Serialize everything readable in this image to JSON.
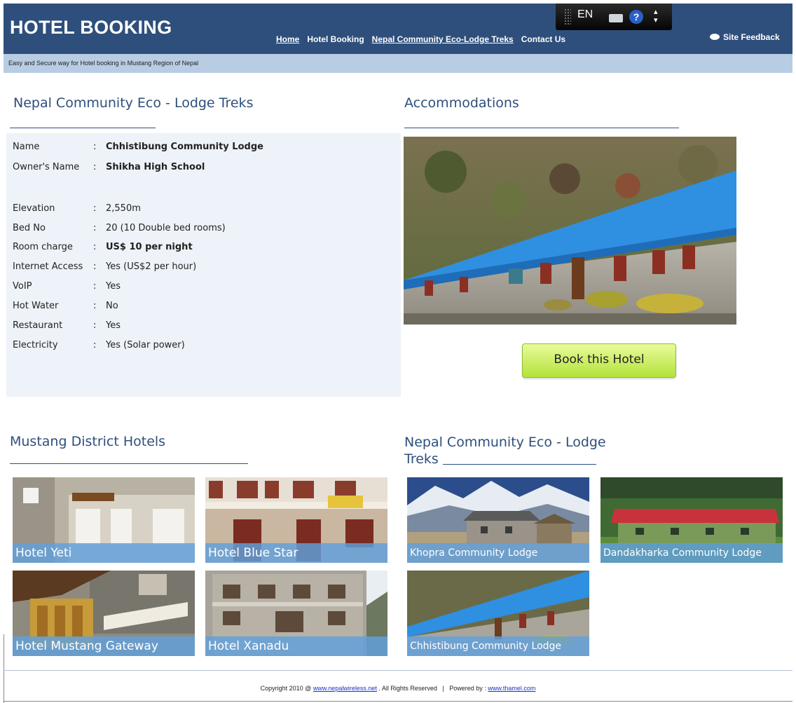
{
  "header": {
    "title": "HOTEL BOOKING",
    "nav": [
      "Home",
      "Hotel Booking",
      "Nepal Community Eco-Lodge Treks",
      "Contact Us"
    ],
    "feedback_label": "Site Feedback",
    "tagline": "Easy and Secure way for Hotel booking in Mustang Region of Nepal"
  },
  "language_bar": {
    "language": "EN",
    "help": "?",
    "arrows": "▴\n▾",
    "icons": [
      "grip-icon",
      "keyboard-icon",
      "help-icon",
      "expand-icon"
    ]
  },
  "details": {
    "heading": "Nepal Community Eco - Lodge Treks",
    "rows": [
      {
        "label": "Name",
        "value": "Chhistibung Community Lodge"
      },
      {
        "label": "Owner's Name",
        "value": "Shikha High School"
      },
      {
        "label": "Elevation",
        "value": "2,550m"
      },
      {
        "label": "Bed No",
        "value": "20 (10 Double bed rooms)"
      },
      {
        "label": "Room charge",
        "value": "US$ 10 per night"
      },
      {
        "label": "Internet Access",
        "value": "Yes (US$2 per hour)"
      },
      {
        "label": "VoIP",
        "value": "Yes"
      },
      {
        "label": "Hot Water",
        "value": "No"
      },
      {
        "label": "Restaurant",
        "value": "Yes"
      },
      {
        "label": "Electricity",
        "value": "Yes (Solar power)"
      }
    ]
  },
  "accommodations": {
    "heading": "Accommodations",
    "book_button": "Book this Hotel"
  },
  "mustang_hotels": {
    "heading": "Mustang District Hotels",
    "items": [
      "Hotel Yeti",
      "Hotel Blue Star",
      "Hotel Mustang Gateway",
      "Hotel Xanadu"
    ]
  },
  "eco_lodges": {
    "heading_line1": "Nepal Community Eco - Lodge",
    "heading_line2": "Treks",
    "items": [
      "Khopra Community Lodge",
      "Dandakharka Community Lodge",
      "Chhistibung Community Lodge"
    ]
  },
  "footer": {
    "copyright": "Copyright 2010 @",
    "link1": "www.nepalwireless.net",
    "rights": ". All Rights Reserved   |   Powered by :",
    "link2": "www.thamel.com"
  },
  "colors": {
    "header_bg": "#2e4f7c",
    "tagline_bg": "#b8cde3",
    "panel_bg": "#eef3f9",
    "roof_blue": "#2f8fe0",
    "button_green": "#b4e23c"
  }
}
